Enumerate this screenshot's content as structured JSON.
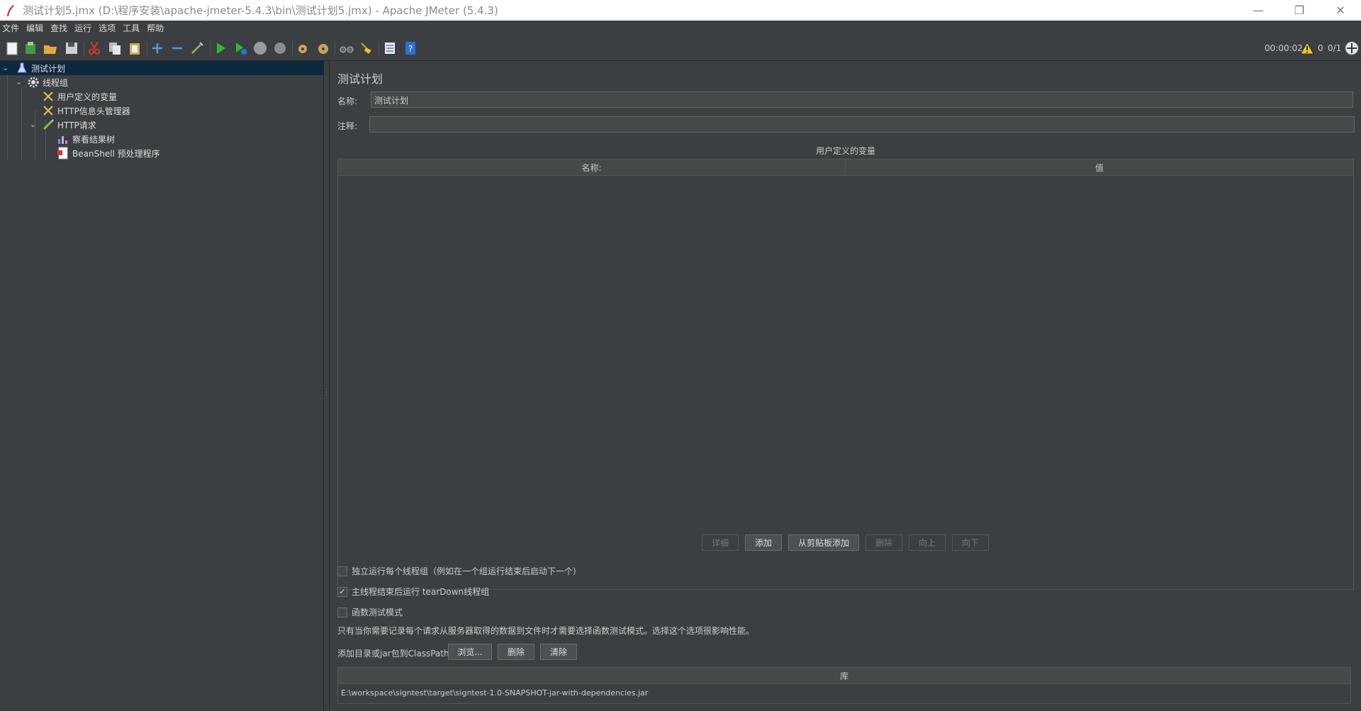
{
  "window": {
    "title": "测试计划5.jmx (D:\\程序安装\\apache-jmeter-5.4.3\\bin\\测试计划5.jmx) - Apache JMeter (5.4.3)",
    "controls": {
      "minimize": "—",
      "restore": "❐",
      "close": "✕"
    }
  },
  "menu": [
    "文件",
    "编辑",
    "查找",
    "运行",
    "选项",
    "工具",
    "帮助"
  ],
  "status": {
    "elapsed": "00:00:02",
    "warnings": "0",
    "threads": "0/1"
  },
  "tree": [
    {
      "label": "测试计划",
      "icon": "flask-icon"
    },
    {
      "label": "线程组",
      "icon": "gear-icon"
    },
    {
      "label": "用户定义的变量",
      "icon": "tools-icon"
    },
    {
      "label": "HTTP信息头管理器",
      "icon": "tools-icon"
    },
    {
      "label": "HTTP请求",
      "icon": "pen-icon"
    },
    {
      "label": "察看结果树",
      "icon": "chart-icon"
    },
    {
      "label": "BeanShell 预处理程序",
      "icon": "script-icon"
    }
  ],
  "main": {
    "heading": "测试计划",
    "name_label": "名称:",
    "name_value": "测试计划",
    "comment_label": "注释:",
    "comment_value": "",
    "vars_title": "用户定义的变量",
    "vars_columns": [
      "名称:",
      "值"
    ],
    "buttons": [
      "详细",
      "添加",
      "从剪贴板添加",
      "删除",
      "向上",
      "向下"
    ],
    "options": [
      {
        "label": "独立运行每个线程组（例如在一个组运行结束后启动下一个）",
        "checked": false
      },
      {
        "label": "主线程结束后运行 tearDown线程组",
        "checked": true
      },
      {
        "label": "函数测试模式",
        "checked": false
      }
    ],
    "functional_note": "只有当你需要记录每个请求从服务器取得的数据到文件时才需要选择函数测试模式。选择这个选项很影响性能。",
    "classpath_label": "添加目录或jar包到ClassPath",
    "classpath_buttons": [
      "浏览...",
      "删除",
      "清除"
    ],
    "lib_header": "库",
    "lib_entries": [
      "E:\\workspace\\signtest\\target\\signtest-1.0-SNAPSHOT-jar-with-dependencies.jar"
    ]
  }
}
